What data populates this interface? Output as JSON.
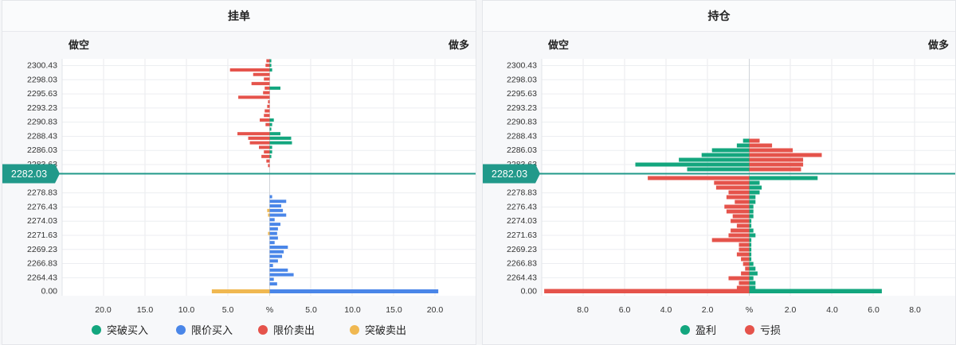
{
  "price_badge": "2282.03",
  "colors": {
    "breakout_buy": "#13a67e",
    "limit_buy": "#4a86e8",
    "limit_sell": "#e5534b",
    "breakout_sell": "#f0b851",
    "profit": "#13a67e",
    "loss": "#e5534b",
    "current_line": "#21998a"
  },
  "chart_data": [
    {
      "type": "bar",
      "title": "挂单",
      "left_label": "做空",
      "right_label": "做多",
      "center_tick": "%",
      "y_tick_labels": [
        "2300.43",
        "2298.03",
        "2295.63",
        "2293.23",
        "2290.83",
        "2288.43",
        "2286.03",
        "2283.63",
        "2278.83",
        "2276.43",
        "2274.03",
        "2271.63",
        "2269.23",
        "2266.83",
        "2264.43",
        "0.00"
      ],
      "x_ticks_left": [
        "20.0",
        "15.0",
        "10.0",
        "5.0"
      ],
      "x_ticks_right": [
        "5.0",
        "10.0",
        "15.0",
        "20.0"
      ],
      "xlim": [
        -25,
        25
      ],
      "series_names": [
        "突破买入",
        "限价买入",
        "限价卖出",
        "突破卖出"
      ],
      "levels": [
        {
          "price": "2301.23",
          "limit_sell": 0.4,
          "breakout_buy": 0.2
        },
        {
          "price": "2300.43",
          "limit_sell": 0.5,
          "breakout_buy": 0.2
        },
        {
          "price": "2299.63",
          "limit_sell": 4.8,
          "breakout_buy": 0.3
        },
        {
          "price": "2298.83",
          "limit_sell": 2.0
        },
        {
          "price": "2298.03",
          "limit_sell": 0.7
        },
        {
          "price": "2297.23",
          "limit_sell": 2.2
        },
        {
          "price": "2296.43",
          "limit_sell": 0.6,
          "breakout_buy": 1.3
        },
        {
          "price": "2295.63",
          "limit_sell": 0.8
        },
        {
          "price": "2294.83",
          "limit_sell": 3.8
        },
        {
          "price": "2294.03",
          "limit_sell": 0.2
        },
        {
          "price": "2293.23",
          "limit_sell": 0.3
        },
        {
          "price": "2292.43",
          "limit_sell": 0.6
        },
        {
          "price": "2291.63",
          "limit_sell": 0.7
        },
        {
          "price": "2290.83",
          "limit_sell": 1.2,
          "breakout_buy": 0.5
        },
        {
          "price": "2290.03",
          "limit_sell": 0.5,
          "breakout_buy": 0.3
        },
        {
          "price": "2289.23",
          "breakout_buy": 0.2
        },
        {
          "price": "2288.43",
          "limit_sell": 3.9,
          "breakout_buy": 1.3
        },
        {
          "price": "2287.63",
          "limit_sell": 2.6,
          "breakout_buy": 2.6
        },
        {
          "price": "2286.83",
          "limit_sell": 2.4,
          "breakout_buy": 2.7
        },
        {
          "price": "2286.03",
          "limit_sell": 1.3,
          "breakout_buy": 0.3
        },
        {
          "price": "2285.23",
          "limit_sell": 0.7,
          "breakout_buy": 0.3
        },
        {
          "price": "2284.43",
          "limit_sell": 1.0,
          "breakout_buy": 0.2
        },
        {
          "price": "2283.63",
          "limit_sell": 0.4
        },
        {
          "price": "2282.83",
          "limit_sell": 0.2
        },
        {
          "price": "2278.83",
          "limit_buy": 0.3
        },
        {
          "price": "2278.03",
          "limit_buy": 2.0
        },
        {
          "price": "2277.23",
          "limit_buy": 1.4
        },
        {
          "price": "2276.43",
          "limit_buy": 1.6,
          "breakout_sell": 0.3
        },
        {
          "price": "2275.63",
          "limit_buy": 2.0,
          "breakout_sell": 0.2
        },
        {
          "price": "2274.83",
          "limit_buy": 0.6
        },
        {
          "price": "2274.03",
          "limit_buy": 1.3
        },
        {
          "price": "2273.23",
          "limit_buy": 1.0
        },
        {
          "price": "2272.43",
          "limit_buy": 0.9,
          "breakout_sell": 0.2
        },
        {
          "price": "2271.63",
          "limit_buy": 1.0
        },
        {
          "price": "2270.83",
          "limit_buy": 0.6
        },
        {
          "price": "2270.03",
          "limit_buy": 2.2
        },
        {
          "price": "2269.23",
          "limit_buy": 1.7
        },
        {
          "price": "2268.43",
          "limit_buy": 1.5
        },
        {
          "price": "2267.63",
          "limit_buy": 1.0
        },
        {
          "price": "2266.83",
          "limit_buy": 0.4
        },
        {
          "price": "2266.03",
          "limit_buy": 2.2
        },
        {
          "price": "2265.23",
          "limit_buy": 2.9
        },
        {
          "price": "2264.43",
          "limit_buy": 0.5
        },
        {
          "price": "2263.63",
          "limit_buy": 0.9
        },
        {
          "price": "0.00",
          "limit_buy": 20.4,
          "breakout_sell": 7.0
        }
      ]
    },
    {
      "type": "bar",
      "title": "持仓",
      "left_label": "做空",
      "right_label": "做多",
      "center_tick": "%",
      "y_tick_labels": [
        "2300.43",
        "2298.03",
        "2295.63",
        "2293.23",
        "2290.83",
        "2288.43",
        "2286.03",
        "2283.63",
        "2278.83",
        "2276.43",
        "2274.03",
        "2271.63",
        "2269.23",
        "2266.83",
        "2264.43",
        "0.00"
      ],
      "x_ticks_left": [
        "8.0",
        "6.0",
        "4.0",
        "2.0"
      ],
      "x_ticks_right": [
        "2.0",
        "4.0",
        "6.0",
        "8.0"
      ],
      "xlim": [
        -10,
        10
      ],
      "series_names": [
        "盈利",
        "亏损"
      ],
      "rows": [
        {
          "price": "2287.63",
          "short_profit": 0.3,
          "short_loss": 0.0,
          "long_profit": 0.0,
          "long_loss": 0.5
        },
        {
          "price": "2286.83",
          "short_profit": 0.6,
          "long_loss": 1.1
        },
        {
          "price": "2286.03",
          "short_profit": 1.8,
          "long_loss": 2.1
        },
        {
          "price": "2285.23",
          "short_profit": 2.3,
          "long_loss": 3.5
        },
        {
          "price": "2284.43",
          "short_profit": 3.4,
          "long_loss": 2.6
        },
        {
          "price": "2283.63",
          "short_profit": 5.5,
          "long_loss": 2.6
        },
        {
          "price": "2282.83",
          "short_profit": 3.0,
          "long_loss": 2.5
        },
        {
          "price": "2281.23",
          "short_loss": 4.9,
          "long_profit": 3.3
        },
        {
          "price": "2280.43",
          "short_loss": 1.7,
          "long_profit": 0.5
        },
        {
          "price": "2279.63",
          "short_loss": 1.6,
          "long_profit": 0.6
        },
        {
          "price": "2278.83",
          "short_loss": 1.0,
          "long_profit": 0.5
        },
        {
          "price": "2278.03",
          "short_loss": 1.1,
          "long_profit": 0.3
        },
        {
          "price": "2277.23",
          "short_loss": 0.7,
          "long_profit": 0.3
        },
        {
          "price": "2276.43",
          "short_loss": 1.2,
          "long_profit": 0.2
        },
        {
          "price": "2275.63",
          "short_loss": 1.1,
          "long_profit": 0.2
        },
        {
          "price": "2274.83",
          "short_loss": 0.8,
          "long_profit": 0.2
        },
        {
          "price": "2274.03",
          "short_loss": 0.9,
          "long_profit": 0.1
        },
        {
          "price": "2273.23",
          "short_loss": 0.6,
          "long_profit": 0.1
        },
        {
          "price": "2272.43",
          "short_loss": 0.9,
          "long_profit": 0.2
        },
        {
          "price": "2271.63",
          "short_loss": 1.0,
          "long_profit": 0.3
        },
        {
          "price": "2270.83",
          "short_loss": 1.8,
          "long_profit": 0.1
        },
        {
          "price": "2270.03",
          "short_loss": 0.5,
          "long_profit": 0.1
        },
        {
          "price": "2269.23",
          "short_loss": 0.5,
          "long_profit": 0.1
        },
        {
          "price": "2268.43",
          "short_loss": 0.6,
          "long_profit": 0.1
        },
        {
          "price": "2267.63",
          "short_loss": 0.4,
          "long_profit": 0.1
        },
        {
          "price": "2266.83",
          "short_loss": 0.3,
          "long_profit": 0.2
        },
        {
          "price": "2266.03",
          "short_loss": 0.2,
          "long_profit": 0.3
        },
        {
          "price": "2265.23",
          "short_loss": 0.4,
          "long_profit": 0.4
        },
        {
          "price": "2264.43",
          "short_loss": 1.0,
          "long_profit": 0.2
        },
        {
          "price": "2263.63",
          "short_loss": 0.5,
          "long_profit": 0.3
        },
        {
          "price": "2262.83",
          "short_loss": 0.6,
          "long_profit": 0.3
        },
        {
          "price": "0.00",
          "short_loss": 9.9,
          "long_profit": 6.4
        }
      ]
    }
  ]
}
